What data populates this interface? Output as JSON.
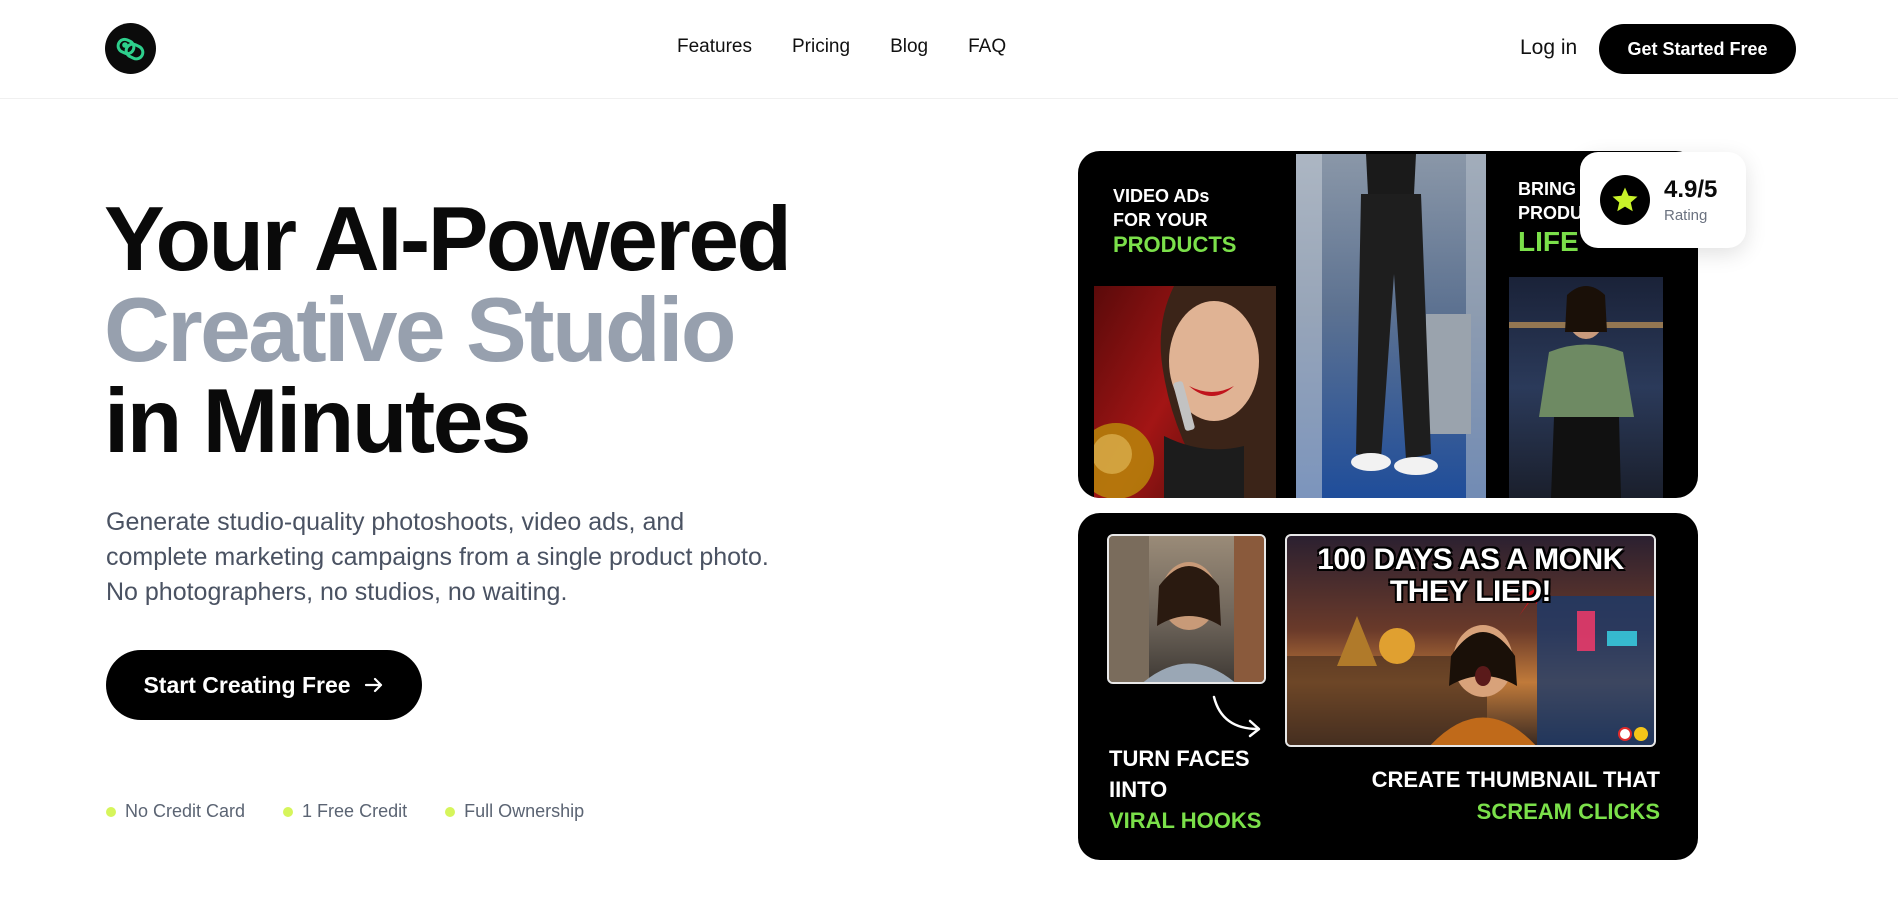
{
  "header": {
    "logo_icon": "link-loop-logo-icon",
    "nav": [
      "Features",
      "Pricing",
      "Blog",
      "FAQ"
    ],
    "login": "Log in",
    "cta": "Get Started Free"
  },
  "hero": {
    "line1": "Your AI-Powered",
    "line2": "Creative Studio",
    "line3": "in Minutes",
    "description": "Generate studio-quality photoshoots, video ads, and complete marketing campaigns from a single product photo. No photographers, no studios, no waiting.",
    "cta": "Start Creating Free",
    "cta_icon": "arrow-right-icon",
    "features": [
      "No Credit Card",
      "1 Free Credit",
      "Full Ownership"
    ]
  },
  "card1": {
    "left_caption": [
      "VIDEO ADs",
      "FOR YOUR",
      "PRODUCTS"
    ],
    "right_caption": [
      "BRING",
      "PRODU",
      "LIFE"
    ]
  },
  "rating": {
    "value": "4.9/5",
    "label": "Rating",
    "icon": "star-icon"
  },
  "card2": {
    "left_caption": [
      "TURN FACES",
      "IINTO",
      "VIRAL HOOKS"
    ],
    "thumb_title": [
      "100 DAYS AS A MONK",
      "THEY LIED!"
    ],
    "right_caption": [
      "CREATE THUMBNAIL THAT",
      "SCREAM CLICKS"
    ]
  },
  "colors": {
    "accent_lime": "#7be04a",
    "dot_lime": "#d6f55b",
    "gray_heading": "#97a0ae",
    "star": "#c8f229"
  }
}
